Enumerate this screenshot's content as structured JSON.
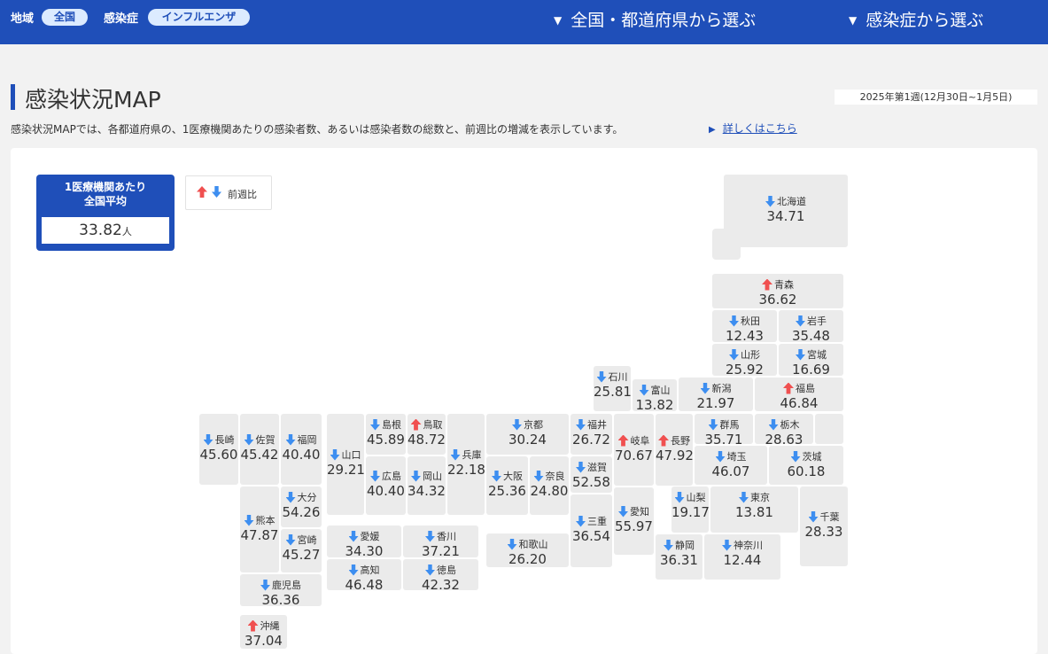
{
  "topbar": {
    "region_label": "地域",
    "region_value": "全国",
    "disease_label": "感染症",
    "disease_value": "インフルエンザ",
    "nav_prefecture": "全国・都道府県から選ぶ",
    "nav_disease": "感染症から選ぶ"
  },
  "header": {
    "title": "感染状況MAP",
    "week": "2025年第1週(12月30日~1月5日)",
    "description": "感染状況MAPでは、各都道府県の、1医療機関あたりの感染者数、あるいは感染者数の総数と、前週比の増減を表示しています。",
    "more_link": "詳しくはこちら"
  },
  "average": {
    "title_line1": "1医療機関あたり",
    "title_line2": "全国平均",
    "value": "33.82",
    "unit": "人"
  },
  "legend": {
    "label": "前週比"
  },
  "colors": {
    "primary": "#1f4fb9",
    "increase": "#f05050",
    "decrease": "#3d8ef0",
    "tile": "#ebebeb"
  },
  "prefectures": [
    {
      "id": "hokkaido",
      "name": "北海道",
      "value": "34.71",
      "trend": "down"
    },
    {
      "id": "aomori",
      "name": "青森",
      "value": "36.62",
      "trend": "up"
    },
    {
      "id": "akita",
      "name": "秋田",
      "value": "12.43",
      "trend": "down"
    },
    {
      "id": "iwate",
      "name": "岩手",
      "value": "35.48",
      "trend": "down"
    },
    {
      "id": "yamagata",
      "name": "山形",
      "value": "25.92",
      "trend": "down"
    },
    {
      "id": "miyagi",
      "name": "宮城",
      "value": "16.69",
      "trend": "down"
    },
    {
      "id": "ishikawa",
      "name": "石川",
      "value": "25.81",
      "trend": "down"
    },
    {
      "id": "toyama",
      "name": "富山",
      "value": "13.82",
      "trend": "down"
    },
    {
      "id": "niigata",
      "name": "新潟",
      "value": "21.97",
      "trend": "down"
    },
    {
      "id": "fukushima",
      "name": "福島",
      "value": "46.84",
      "trend": "up"
    },
    {
      "id": "nagasaki",
      "name": "長崎",
      "value": "45.60",
      "trend": "down"
    },
    {
      "id": "saga",
      "name": "佐賀",
      "value": "45.42",
      "trend": "down"
    },
    {
      "id": "fukuoka",
      "name": "福岡",
      "value": "40.40",
      "trend": "down"
    },
    {
      "id": "yamaguchi",
      "name": "山口",
      "value": "29.21",
      "trend": "down"
    },
    {
      "id": "shimane",
      "name": "島根",
      "value": "45.89",
      "trend": "down"
    },
    {
      "id": "tottori",
      "name": "鳥取",
      "value": "48.72",
      "trend": "up"
    },
    {
      "id": "hyogo",
      "name": "兵庫",
      "value": "22.18",
      "trend": "down"
    },
    {
      "id": "kyoto",
      "name": "京都",
      "value": "30.24",
      "trend": "down"
    },
    {
      "id": "fukui",
      "name": "福井",
      "value": "26.72",
      "trend": "down"
    },
    {
      "id": "gifu",
      "name": "岐阜",
      "value": "70.67",
      "trend": "up"
    },
    {
      "id": "nagano",
      "name": "長野",
      "value": "47.92",
      "trend": "up"
    },
    {
      "id": "gunma",
      "name": "群馬",
      "value": "35.71",
      "trend": "down"
    },
    {
      "id": "tochigi",
      "name": "栃木",
      "value": "28.63",
      "trend": "down"
    },
    {
      "id": "hiroshima",
      "name": "広島",
      "value": "40.40",
      "trend": "down"
    },
    {
      "id": "okayama",
      "name": "岡山",
      "value": "34.32",
      "trend": "down"
    },
    {
      "id": "osaka",
      "name": "大阪",
      "value": "25.36",
      "trend": "down"
    },
    {
      "id": "nara",
      "name": "奈良",
      "value": "24.80",
      "trend": "down"
    },
    {
      "id": "shiga",
      "name": "滋賀",
      "value": "52.58",
      "trend": "down"
    },
    {
      "id": "saitama",
      "name": "埼玉",
      "value": "46.07",
      "trend": "down"
    },
    {
      "id": "ibaraki",
      "name": "茨城",
      "value": "60.18",
      "trend": "down"
    },
    {
      "id": "kumamoto",
      "name": "熊本",
      "value": "47.87",
      "trend": "down"
    },
    {
      "id": "oita",
      "name": "大分",
      "value": "54.26",
      "trend": "down"
    },
    {
      "id": "miyazaki",
      "name": "宮崎",
      "value": "45.27",
      "trend": "down"
    },
    {
      "id": "ehime",
      "name": "愛媛",
      "value": "34.30",
      "trend": "down"
    },
    {
      "id": "kagawa",
      "name": "香川",
      "value": "37.21",
      "trend": "down"
    },
    {
      "id": "kochi",
      "name": "高知",
      "value": "46.48",
      "trend": "down"
    },
    {
      "id": "tokushima",
      "name": "徳島",
      "value": "42.32",
      "trend": "down"
    },
    {
      "id": "wakayama",
      "name": "和歌山",
      "value": "26.20",
      "trend": "down"
    },
    {
      "id": "mie",
      "name": "三重",
      "value": "36.54",
      "trend": "down"
    },
    {
      "id": "aichi",
      "name": "愛知",
      "value": "55.97",
      "trend": "down"
    },
    {
      "id": "yamanashi",
      "name": "山梨",
      "value": "19.17",
      "trend": "down"
    },
    {
      "id": "tokyo",
      "name": "東京",
      "value": "13.81",
      "trend": "down"
    },
    {
      "id": "chiba",
      "name": "千葉",
      "value": "28.33",
      "trend": "down"
    },
    {
      "id": "shizuoka",
      "name": "静岡",
      "value": "36.31",
      "trend": "down"
    },
    {
      "id": "kanagawa",
      "name": "神奈川",
      "value": "12.44",
      "trend": "down"
    },
    {
      "id": "kagoshima",
      "name": "鹿児島",
      "value": "36.36",
      "trend": "down"
    },
    {
      "id": "okinawa",
      "name": "沖縄",
      "value": "37.04",
      "trend": "up"
    }
  ]
}
